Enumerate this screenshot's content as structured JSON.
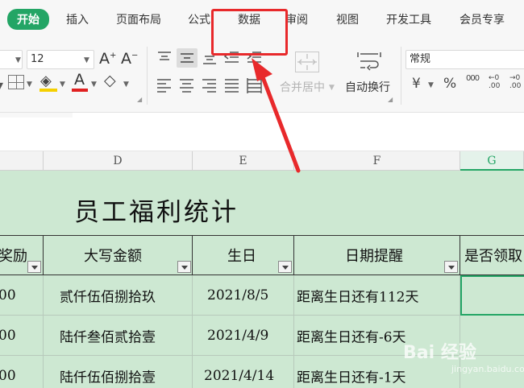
{
  "menu": {
    "tabs": [
      "开始",
      "插入",
      "页面布局",
      "公式",
      "数据",
      "审阅",
      "视图",
      "开发工具",
      "会员专享"
    ],
    "active_tab": "开始",
    "highlighted_tab": "数据"
  },
  "ribbon": {
    "font_size": "12",
    "merge_label": "合并居中",
    "wrap_label": "自动换行",
    "number_format": "常规",
    "currency_symbol": "¥",
    "percent_symbol": "%",
    "thousands_symbol": "000",
    "dec_increase": "←0 .00",
    "dec_decrease": "→0 .00"
  },
  "columns": [
    "D",
    "E",
    "F",
    "G"
  ],
  "selected_column": "G",
  "sheet": {
    "title": "员工福利统计",
    "headers": [
      "奖励",
      "大写金额",
      "生日",
      "日期提醒",
      "是否领取"
    ],
    "rows": [
      [
        "00",
        "贰仟伍佰捌拾玖",
        "2021/8/5",
        "距离生日还有112天",
        ""
      ],
      [
        "00",
        "陆仟叁佰贰拾壹",
        "2021/4/9",
        "距离生日还有-6天",
        ""
      ],
      [
        "00",
        "陆仟伍佰捌拾壹",
        "2021/4/14",
        "距离生日还有-1天",
        ""
      ]
    ]
  },
  "watermark": {
    "text": "Bai 经验",
    "sub": "jingyan.baidu.com"
  },
  "colors": {
    "accent": "#23a565",
    "annotation": "#e8292b",
    "sheet_bg": "#cde8d2"
  }
}
